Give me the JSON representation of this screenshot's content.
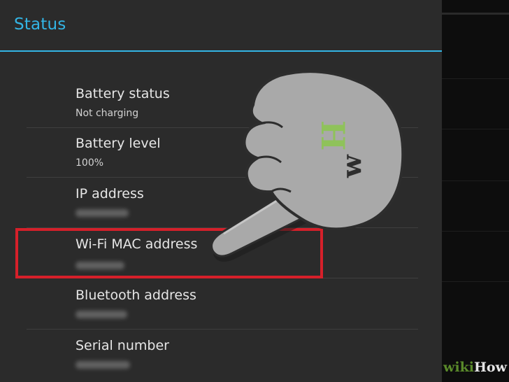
{
  "dialog": {
    "title": "Status"
  },
  "rows": [
    {
      "label": "Battery status",
      "value": "Not charging"
    },
    {
      "label": "Battery level",
      "value": "100%"
    },
    {
      "label": "IP address",
      "value": ""
    },
    {
      "label": "Wi-Fi MAC address",
      "value": ""
    },
    {
      "label": "Bluetooth address",
      "value": ""
    },
    {
      "label": "Serial number",
      "value": ""
    }
  ],
  "overlay": {
    "hand_icon": "pointing-hand-icon",
    "hand_letters": "wH",
    "highlight_color": "#d6202a"
  },
  "watermark": {
    "part1": "wiki",
    "part2": "How"
  },
  "colors": {
    "accent": "#33b5e5",
    "dialog_bg": "#2b2b2b"
  }
}
